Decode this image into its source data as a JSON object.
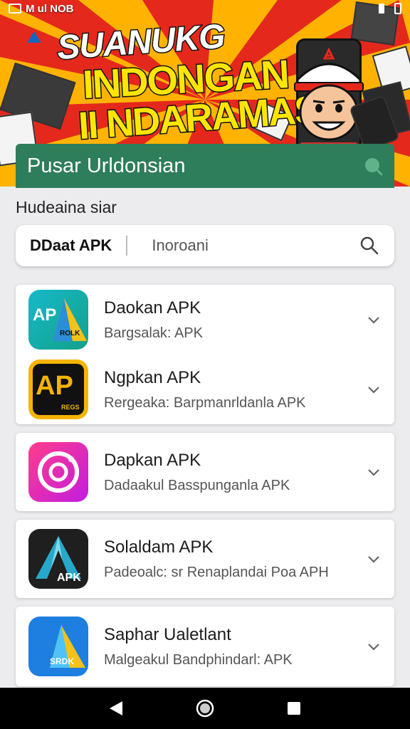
{
  "status_bar": {
    "left_text": "M ul NOB",
    "right_icons": [
      "notification-icon",
      "signal-icon",
      "battery-icon"
    ]
  },
  "banner": {
    "line1": "SUANUKG",
    "line2": "INDONGAN",
    "line3": "II NDARAMAS!",
    "colors": {
      "background": "#ffb300",
      "rays": "#e5281c",
      "title_fill": "#ffe600"
    }
  },
  "header": {
    "title": "Pusar Urldonsian",
    "search_icon": "search-icon",
    "color": "#2e7d5b"
  },
  "section_label": "Hudeaina siar",
  "search": {
    "category_label": "DDaat APK",
    "placeholder": "Inoroani",
    "icon": "search-icon"
  },
  "apps": [
    {
      "name": "Daokan APK",
      "desc": "Bargsalak: APK",
      "icon_text": "AP",
      "icon_sub": "ROLK"
    },
    {
      "name": "Ngpkan APK",
      "desc": "Rergeaka: Barpmanrldanla APK",
      "icon_text": "AP",
      "icon_sub": "REGS"
    },
    {
      "name": "Dapkan APK",
      "desc": "Dadaakul Basspunganla APK"
    },
    {
      "name": "Solaldam APK",
      "desc": "Padeoalc: sr Renaplandai Poa APH",
      "icon_text": "APK"
    },
    {
      "name": "Saphar Ualetlant",
      "desc": "Malgeakul Bandphindarl: APK",
      "icon_text": "SRDK"
    }
  ],
  "nav": {
    "back": "back-icon",
    "home": "home-icon",
    "recents": "recents-icon"
  }
}
